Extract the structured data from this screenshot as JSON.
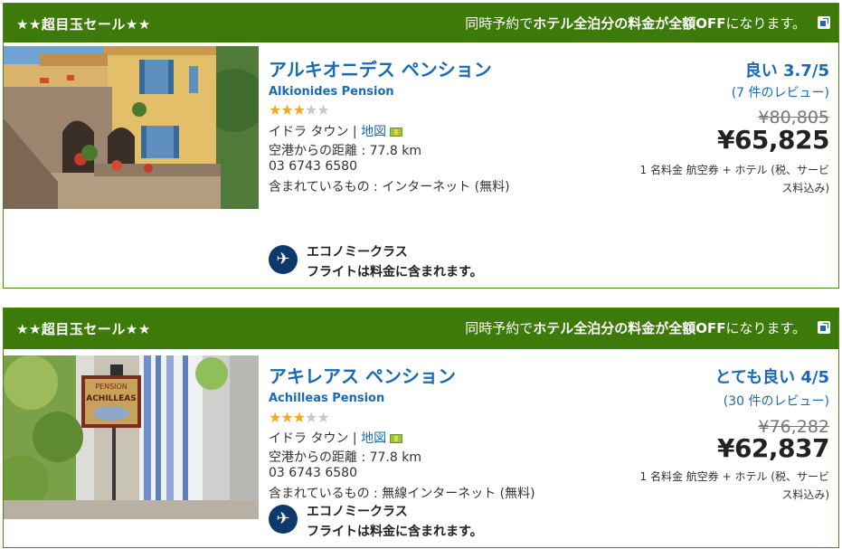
{
  "cards": [
    {
      "banner_left": "★★超目玉セール★★",
      "banner_prefix": "同時予約で",
      "banner_bold": "ホテル全泊分の料金が全額OFF",
      "banner_suffix": "になります。",
      "name_ja": "アルキオニデス ペンション",
      "name_en": "Alkionides Pension",
      "stars": 3,
      "location": "イドラ タウン",
      "map_label": "地図",
      "distance": "空港からの距離 : 77.8 km",
      "phone": "03 6743 6580",
      "includes": "含まれているもの : インターネット (無料)",
      "flight_line1": "エコノミークラス",
      "flight_line2": "フライトは料金に含まれます。",
      "rating_word": "良い 3.7/5",
      "reviews": "(7 件のレビュー)",
      "old_price": "¥80,805",
      "price": "¥65,825",
      "price_note": "1 名料金  航空券 + ホテル (税、サービス料込み)"
    },
    {
      "banner_left": "★★超目玉セール★★",
      "banner_prefix": "同時予約で",
      "banner_bold": "ホテル全泊分の料金が全額OFF",
      "banner_suffix": "になります。",
      "name_ja": "アキレアス ペンション",
      "name_en": "Achilleas Pension",
      "stars": 3,
      "location": "イドラ タウン",
      "map_label": "地図",
      "distance": "空港からの距離 : 77.8 km",
      "phone": "03 6743 6580",
      "includes": "含まれているもの : 無線インターネット (無料)",
      "flight_line1": "エコノミークラス",
      "flight_line2": "フライトは料金に含まれます。",
      "rating_word": "とても良い 4/5",
      "reviews": "(30 件のレビュー)",
      "old_price": "¥76,282",
      "price": "¥62,837",
      "price_note": "1 名料金  航空券 + ホテル (税、サービス料込み)",
      "sign_top": "PENSION",
      "sign_main": "ACHILLEAS"
    }
  ],
  "colors": {
    "banner": "#3d7a0a",
    "link": "#1a6bb3",
    "star": "#f5a623",
    "plane": "#0e3a6b"
  },
  "icons": [
    "info-popup-icon",
    "map-icon",
    "airplane-icon",
    "star-icon"
  ]
}
